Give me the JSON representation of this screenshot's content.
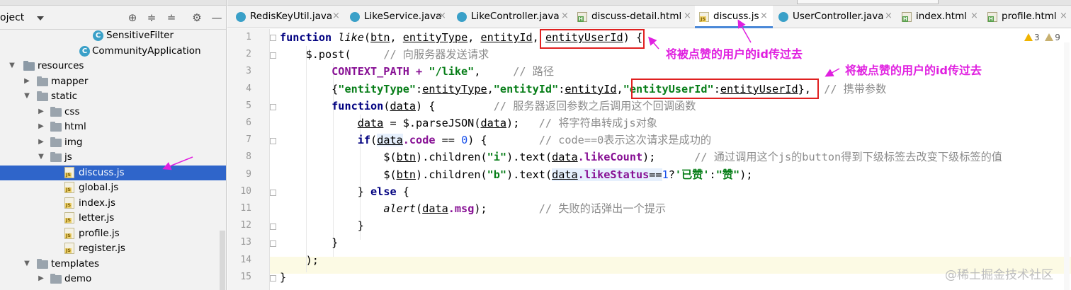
{
  "project_panel": {
    "title": "oject",
    "tree": [
      {
        "label": "SensitiveFilter",
        "kind": "class"
      },
      {
        "label": "CommunityApplication",
        "kind": "class-run"
      },
      {
        "label": "resources",
        "kind": "folder-res"
      },
      {
        "label": "mapper",
        "kind": "folder"
      },
      {
        "label": "static",
        "kind": "folder"
      },
      {
        "label": "css",
        "kind": "folder"
      },
      {
        "label": "html",
        "kind": "folder"
      },
      {
        "label": "img",
        "kind": "folder"
      },
      {
        "label": "js",
        "kind": "folder"
      },
      {
        "label": "discuss.js",
        "kind": "js",
        "selected": true
      },
      {
        "label": "global.js",
        "kind": "js"
      },
      {
        "label": "index.js",
        "kind": "js"
      },
      {
        "label": "letter.js",
        "kind": "js"
      },
      {
        "label": "profile.js",
        "kind": "js"
      },
      {
        "label": "register.js",
        "kind": "js"
      },
      {
        "label": "templates",
        "kind": "folder"
      },
      {
        "label": "demo",
        "kind": "folder"
      }
    ]
  },
  "tabs": [
    {
      "label": "RedisKeyUtil.java",
      "icon": "class-icon"
    },
    {
      "label": "LikeService.java",
      "icon": "class-icon"
    },
    {
      "label": "LikeController.java",
      "icon": "class-icon"
    },
    {
      "label": "discuss-detail.html",
      "icon": "html-file-icon"
    },
    {
      "label": "discuss.js",
      "icon": "js-file-icon",
      "active": true
    },
    {
      "label": "UserController.java",
      "icon": "class-icon"
    },
    {
      "label": "index.html",
      "icon": "html-file-icon"
    },
    {
      "label": "profile.html",
      "icon": "html-file-icon"
    }
  ],
  "inspections": {
    "warnings": "3",
    "weak_warnings": "9"
  },
  "code": {
    "line_numbers": [
      "1",
      "2",
      "3",
      "4",
      "5",
      "6",
      "7",
      "8",
      "9",
      "10",
      "11",
      "12",
      "13",
      "14",
      "15"
    ],
    "l1": {
      "kw": "function",
      "name": "like",
      "p1": "btn",
      "p2": "entityType",
      "p3": "entityId",
      "p4": "entityUserId",
      "end": ") {"
    },
    "l2": {
      "code": "$.post(",
      "comment": "// 向服务器发送请求"
    },
    "l3": {
      "a": "CONTEXT_PATH + ",
      "s": "\"/like\"",
      "c": ",",
      "comment": "// 路径"
    },
    "l4": {
      "k1": "\"entityType\"",
      "v1": "entityType",
      "k2": "\"entityId\"",
      "v2": "entityId",
      "k3": "\"entityUserId\"",
      "v3": "entityUserId",
      "end": "},",
      "comment": "// 携带参数"
    },
    "l5": {
      "kw": "function",
      "arg": "data",
      "end": ") {",
      "comment": "// 服务器返回参数之后调用这个回调函数"
    },
    "l6": {
      "v": "data",
      "m": " = $.parseJSON(",
      "a": "data",
      "e": ");",
      "comment": "// 将字符串转成js对象"
    },
    "l7": {
      "kw": "if",
      "v": "data",
      "p": ".code",
      "op": " == ",
      "n": "0",
      "e": ") {",
      "comment": "// code==0表示这次请求是成功的"
    },
    "l8": {
      "a": "$(",
      "b": "btn",
      "c": ").children(",
      "s": "\"i\"",
      "d": ").text(",
      "v": "data",
      "p": ".likeCount",
      "e": ");",
      "comment": "// 通过调用这个js的button得到下级标签去改变下级标签的值"
    },
    "l9": {
      "a": "$(",
      "b": "btn",
      "c": ").children(",
      "s": "\"b\"",
      "d": ").text(",
      "v": "data",
      "p": ".likeStatus",
      "op": "==",
      "n": "1",
      "q": "?",
      "s1": "'已赞'",
      "col": ":",
      "s2": "\"赞\"",
      "e": ");"
    },
    "l10": {
      "a": "} ",
      "kw": "else",
      "b": " {"
    },
    "l11": {
      "fn": "alert",
      "a": "(",
      "v": "data",
      "p": ".msg",
      "e": ");",
      "comment": "// 失败的话弹出一个提示"
    },
    "l12": {
      "t": "}"
    },
    "l13": {
      "t": "}"
    },
    "l14": {
      "t": ");"
    },
    "l15": {
      "t": "}"
    }
  },
  "annotations": {
    "note1": "将被点赞的用户的id传过去",
    "note2": "将被点赞的用户的id传过去"
  },
  "watermark": "@稀土掘金技术社区",
  "colors": {
    "selection": "#2f65ca",
    "annotation": "#e020e0",
    "redbox": "#e02020"
  }
}
